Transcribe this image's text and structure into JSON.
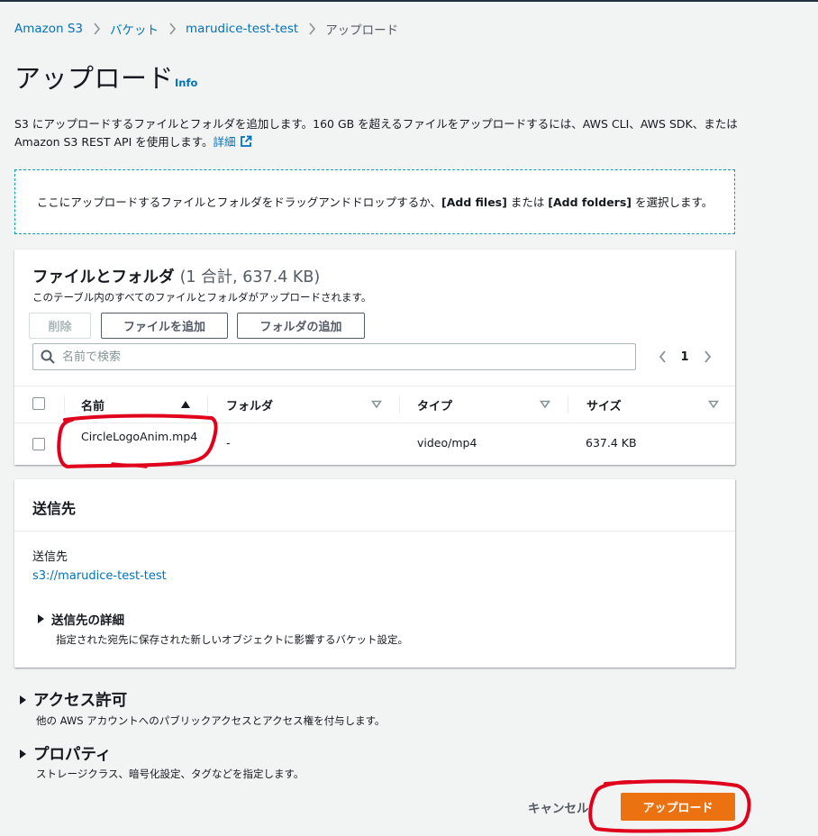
{
  "breadcrumb": {
    "items": [
      "Amazon S3",
      "バケット",
      "marudice-test-test"
    ],
    "current": "アップロード"
  },
  "page": {
    "title": "アップロード",
    "info_link": "Info",
    "description": "S3 にアップロードするファイルとフォルダを追加します。160 GB を超えるファイルをアップロードするには、AWS CLI、AWS SDK、または Amazon S3 REST API を使用します。",
    "description_link": "詳細"
  },
  "dropzone": {
    "text_before": "ここにアップロードするファイルとフォルダをドラッグアンドドロップするか、",
    "add_files": "[Add files]",
    "text_middle": " または ",
    "add_folders": "[Add folders]",
    "text_after": " を選択します。"
  },
  "files_panel": {
    "title": "ファイルとフォルダ",
    "count": "(1 合計, 637.4 KB)",
    "subtitle": "このテーブル内のすべてのファイルとフォルダがアップロードされます。",
    "delete_label": "削除",
    "add_files_label": "ファイルを追加",
    "add_folder_label": "フォルダの追加",
    "search_placeholder": "名前で検索",
    "page_number": "1",
    "columns": [
      "名前",
      "フォルダ",
      "タイプ",
      "サイズ"
    ],
    "rows": [
      {
        "name": "CircleLogoAnim.mp4",
        "folder": "-",
        "type": "video/mp4",
        "size": "637.4 KB"
      }
    ]
  },
  "destination": {
    "title": "送信先",
    "label": "送信先",
    "path": "s3://marudice-test-test",
    "details_title": "送信先の詳細",
    "details_desc": "指定された宛先に保存された新しいオブジェクトに影響するバケット設定。"
  },
  "access": {
    "title": "アクセス許可",
    "desc": "他の AWS アカウントへのパブリックアクセスとアクセス権を付与します。"
  },
  "properties": {
    "title": "プロパティ",
    "desc": "ストレージクラス、暗号化設定、タグなどを指定します。"
  },
  "footer": {
    "cancel_label": "キャンセル",
    "upload_label": "アップロード"
  },
  "colors": {
    "link": "#0073bb",
    "primary_button": "#ec7211",
    "annotation": "#e0001b"
  }
}
